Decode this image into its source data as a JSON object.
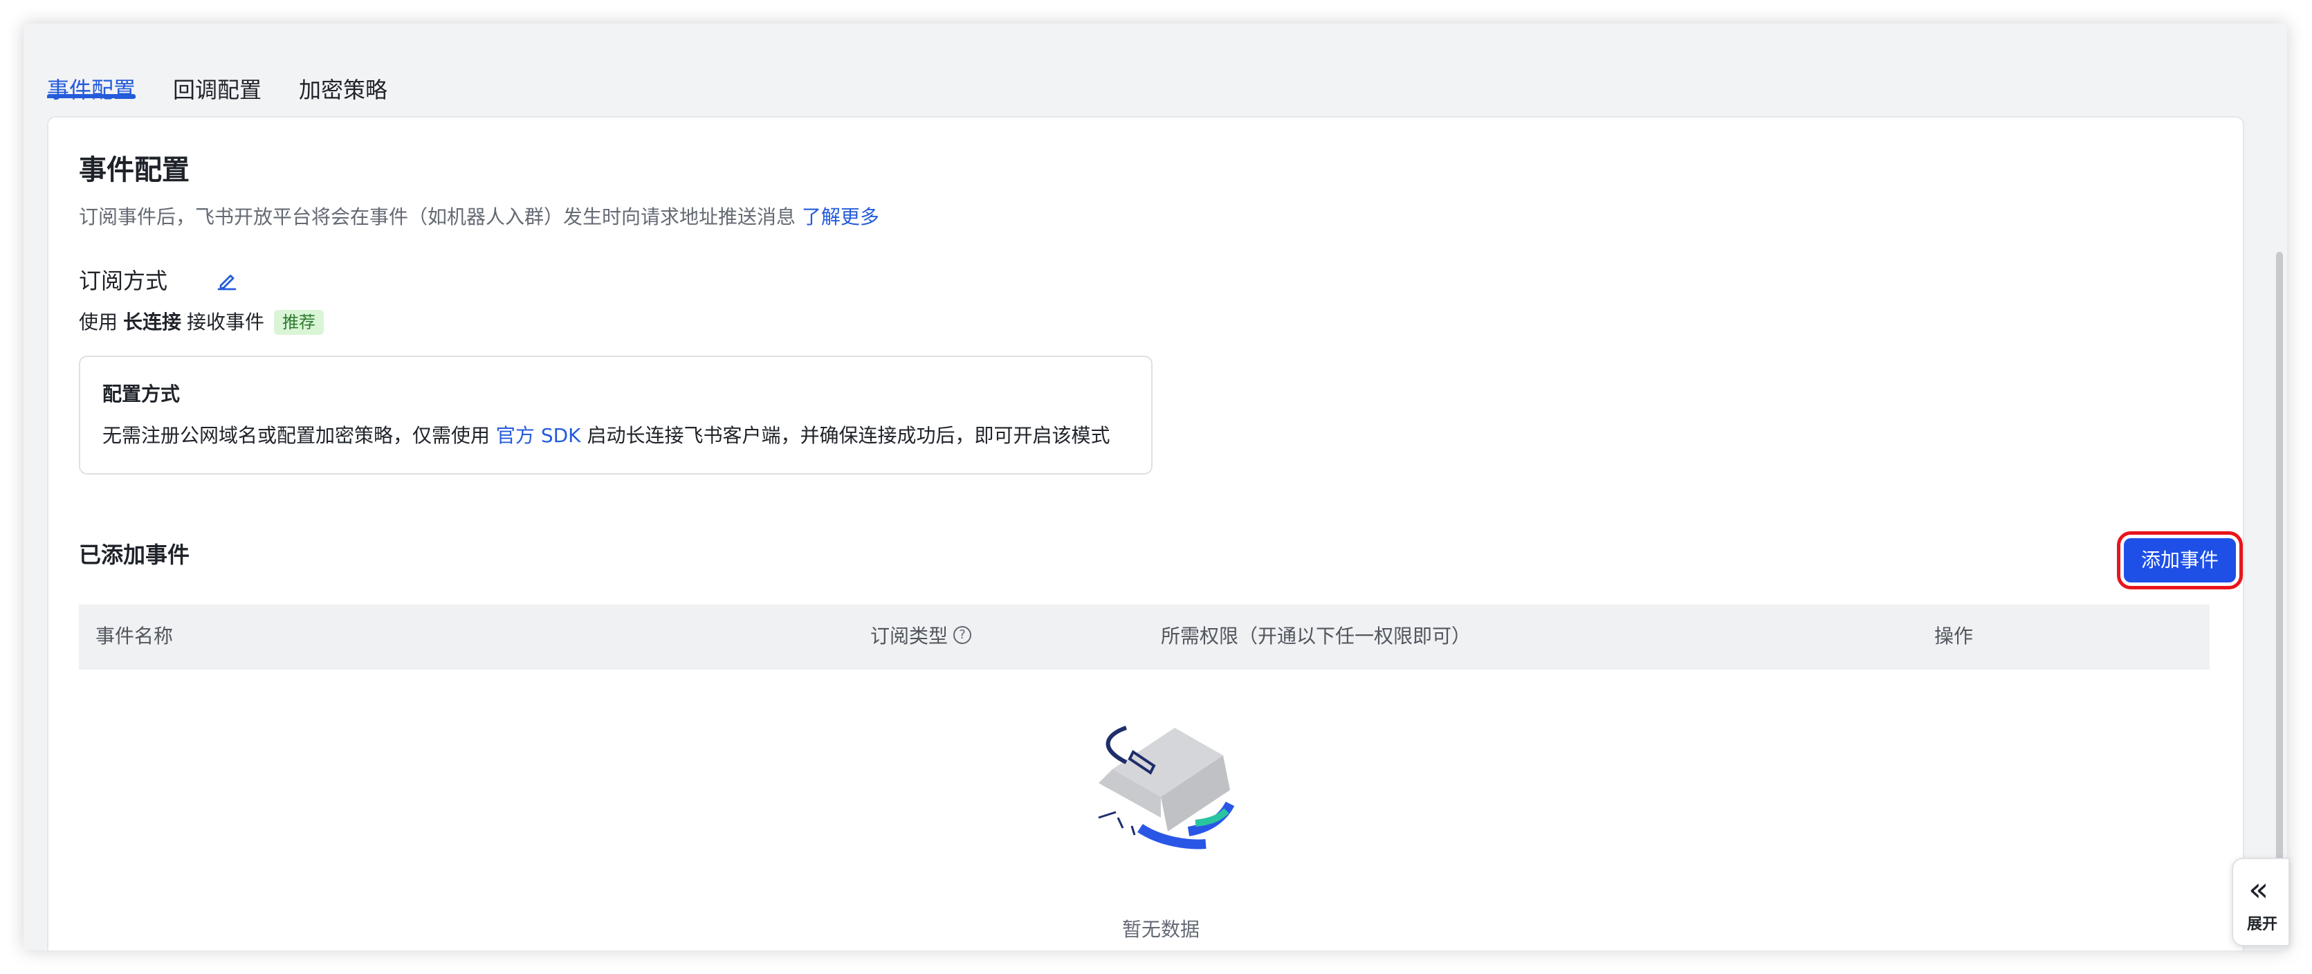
{
  "tabs": [
    {
      "label": "事件配置",
      "active": true
    },
    {
      "label": "回调配置",
      "active": false
    },
    {
      "label": "加密策略",
      "active": false
    }
  ],
  "section": {
    "title": "事件配置",
    "description": "订阅事件后，飞书开放平台将会在事件（如机器人入群）发生时向请求地址推送消息",
    "learn_more": "了解更多"
  },
  "subscription": {
    "title": "订阅方式",
    "edit_icon": "edit-icon",
    "prefix": "使用",
    "method": "长连接",
    "suffix": "接收事件",
    "badge": "推荐"
  },
  "config_box": {
    "title": "配置方式",
    "text_before": "无需注册公网域名或配置加密策略，仅需使用",
    "sdk_link": "官方 SDK",
    "text_after": "启动长连接飞书客户端，并确保连接成功后，即可开启该模式"
  },
  "added_events": {
    "title": "已添加事件",
    "add_button": "添加事件",
    "columns": [
      "事件名称",
      "订阅类型",
      "所需权限（开通以下任一权限即可）",
      "操作"
    ],
    "help_icon": "question-circle-icon",
    "rows": [],
    "empty_text": "暂无数据"
  },
  "side_toggle": {
    "icon": "double-chevron-left-icon",
    "label": "展开"
  },
  "colors": {
    "primary": "#245bdb",
    "button": "#1e50e8",
    "highlight": "#e8141b",
    "badge_bg": "#d9f5d6"
  }
}
